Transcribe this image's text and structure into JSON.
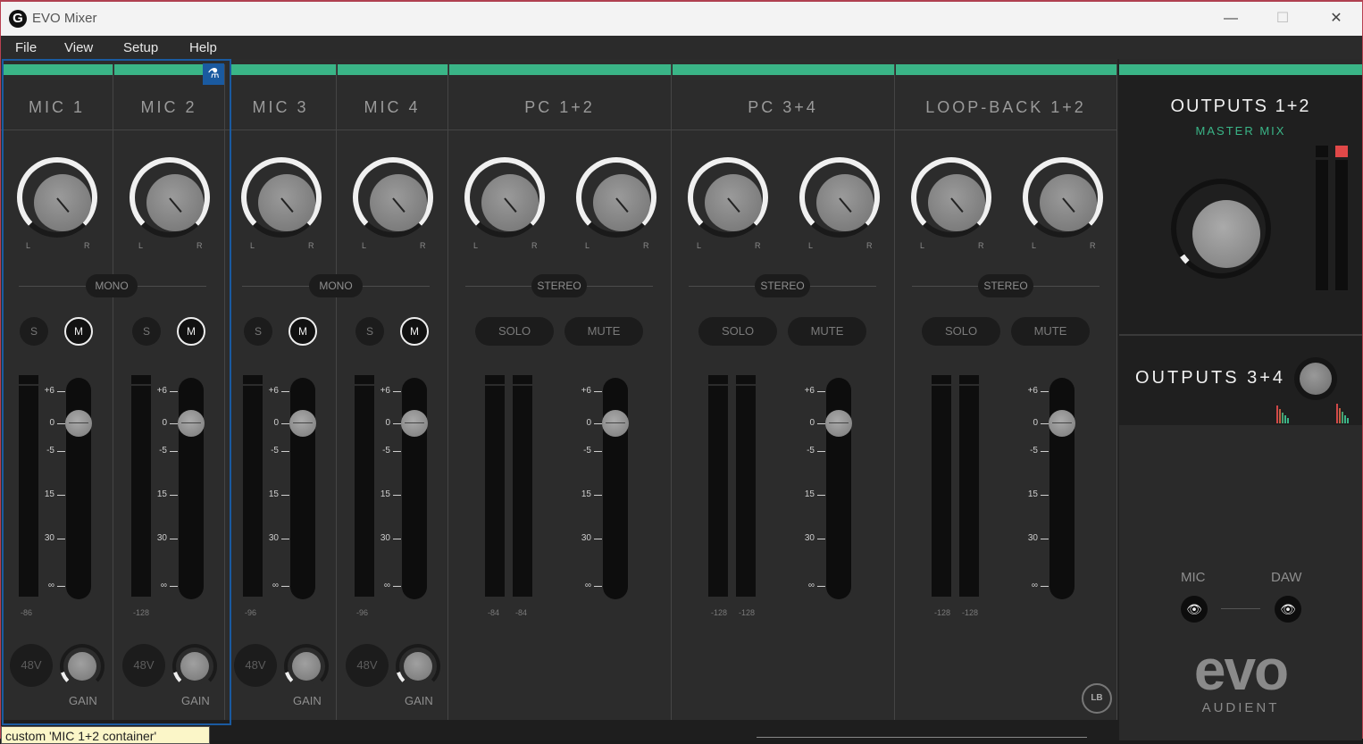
{
  "window": {
    "title": "EVO Mixer",
    "logo": "G",
    "minimize_icon": "—",
    "maximize_icon": "☐",
    "close_icon": "✕"
  },
  "menu": [
    "File",
    "View",
    "Setup",
    "Help"
  ],
  "colors": {
    "accent": "#3ab587",
    "selection": "#1a5aa0",
    "clip": "#e04848"
  },
  "channels": [
    {
      "name": "MIC 1",
      "type": "mic",
      "pan_l": "L",
      "pan_r": "R",
      "solo": "S",
      "mute": "M",
      "phantom": "48V",
      "gain": "GAIN",
      "peak": [
        "-86"
      ]
    },
    {
      "name": "MIC 2",
      "type": "mic",
      "pan_l": "L",
      "pan_r": "R",
      "solo": "S",
      "mute": "M",
      "phantom": "48V",
      "gain": "GAIN",
      "peak": [
        "-128"
      ]
    },
    {
      "name": "MIC 3",
      "type": "mic",
      "pan_l": "L",
      "pan_r": "R",
      "solo": "S",
      "mute": "M",
      "phantom": "48V",
      "gain": "GAIN",
      "peak": [
        "-96"
      ]
    },
    {
      "name": "MIC 4",
      "type": "mic",
      "pan_l": "L",
      "pan_r": "R",
      "solo": "S",
      "mute": "M",
      "phantom": "48V",
      "gain": "GAIN",
      "peak": [
        "-96"
      ]
    },
    {
      "name": "PC 1+2",
      "type": "stereo",
      "pan_l": "L",
      "pan_r": "R",
      "solo": "SOLO",
      "mute": "MUTE",
      "peak": [
        "-84",
        "-84"
      ]
    },
    {
      "name": "PC 3+4",
      "type": "stereo",
      "pan_l": "L",
      "pan_r": "R",
      "solo": "SOLO",
      "mute": "MUTE",
      "peak": [
        "-128",
        "-128"
      ]
    },
    {
      "name": "LOOP-BACK 1+2",
      "type": "stereo",
      "pan_l": "L",
      "pan_r": "R",
      "solo": "SOLO",
      "mute": "MUTE",
      "peak": [
        "-128",
        "-128"
      ]
    }
  ],
  "modes": [
    "MONO",
    "MONO",
    "STEREO",
    "STEREO",
    "STEREO"
  ],
  "fader_scale": [
    "+6",
    "0",
    "-5",
    "15",
    "30",
    "∞"
  ],
  "selection_icon": "flask-icon",
  "flask_glyph": "⚗",
  "loopback_icon": "LB",
  "outputs": {
    "out12_title": "OUTPUTS 1+2",
    "out12_sub": "MASTER MIX",
    "out34_title": "OUTPUTS 3+4",
    "mic_label": "MIC",
    "daw_label": "DAW",
    "eye_glyph": "👁",
    "brand": "evo",
    "brand_sub": "AUDIENT"
  },
  "tooltip": "custom 'MIC 1+2 container'"
}
